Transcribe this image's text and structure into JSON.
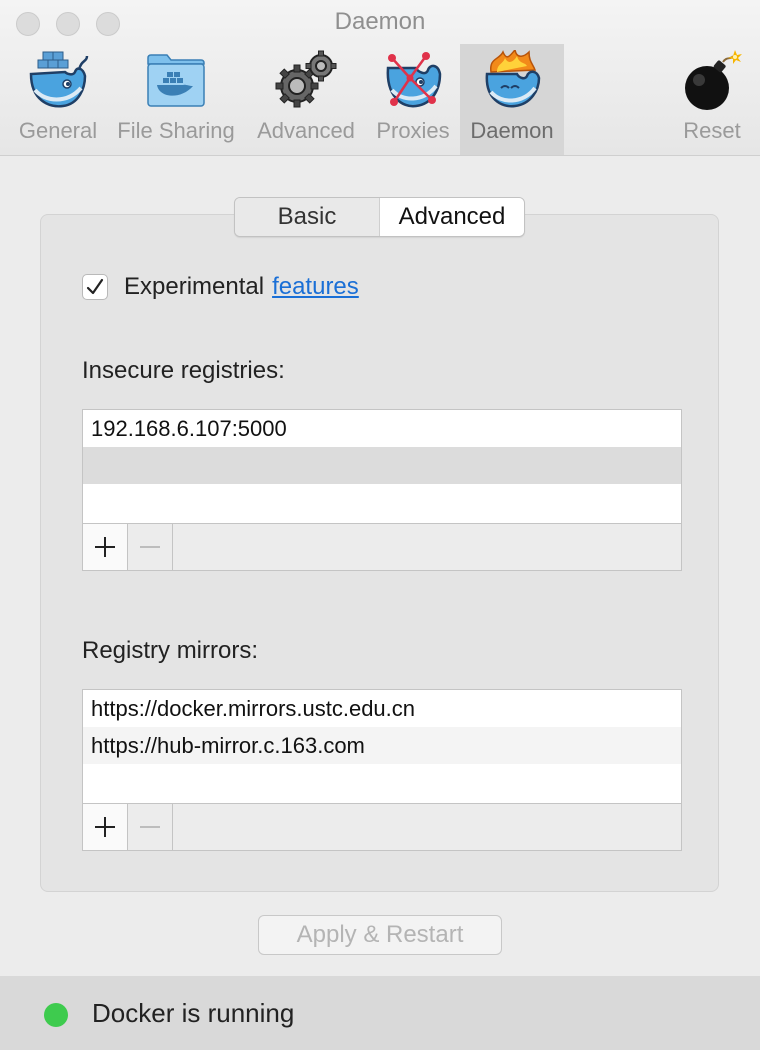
{
  "window": {
    "title": "Daemon"
  },
  "toolbar": {
    "items": [
      {
        "label": "General",
        "icon": "docker-whale-icon"
      },
      {
        "label": "File Sharing",
        "icon": "shared-folder-icon"
      },
      {
        "label": "Advanced",
        "icon": "gears-icon"
      },
      {
        "label": "Proxies",
        "icon": "proxy-whale-icon"
      },
      {
        "label": "Daemon",
        "icon": "fire-whale-icon",
        "active": true
      },
      {
        "label": "Reset",
        "icon": "bomb-icon"
      }
    ]
  },
  "tabs": {
    "basic": "Basic",
    "advanced": "Advanced",
    "selected": "Advanced"
  },
  "experimental": {
    "checked": true,
    "label": "Experimental",
    "link": "features"
  },
  "insecure_registries": {
    "label": "Insecure registries:",
    "items": [
      "192.168.6.107:5000"
    ]
  },
  "registry_mirrors": {
    "label": "Registry mirrors:",
    "items": [
      "https://docker.mirrors.ustc.edu.cn",
      "https://hub-mirror.c.163.com"
    ]
  },
  "apply_button": "Apply & Restart",
  "status": {
    "text": "Docker is running",
    "color": "#3ecb4e"
  },
  "colors": {
    "accent_link": "#1a6fd6",
    "docker_blue": "#3d9ad6"
  }
}
